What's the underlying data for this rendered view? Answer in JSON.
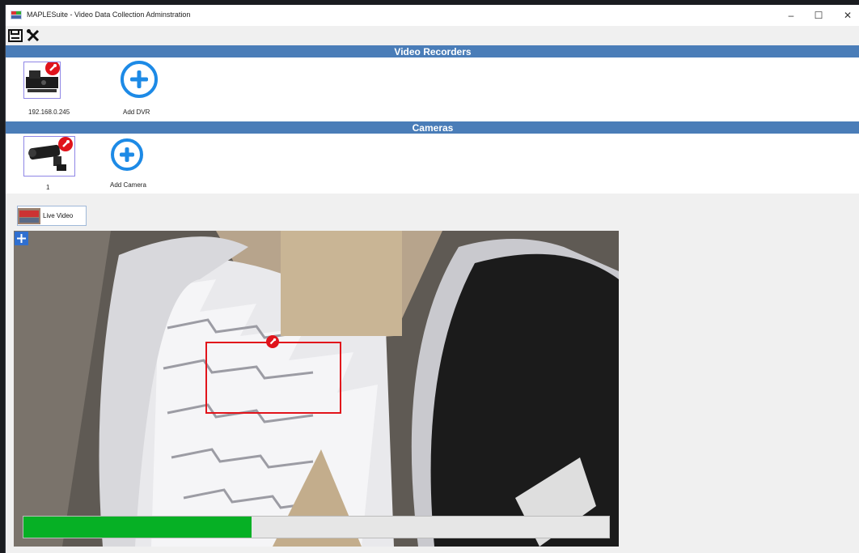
{
  "window": {
    "title": "MAPLESuite - Video Data Collection Adminstration",
    "minimize_glyph": "–",
    "maximize_glyph": "☐",
    "close_glyph": "✕"
  },
  "toolbar": {
    "save_icon": "save-icon",
    "settings_icon": "tools-icon"
  },
  "video_recorders": {
    "header": "Video Recorders",
    "items": [
      {
        "label": "192.168.0.245",
        "status": "error"
      }
    ],
    "add_label": "Add DVR"
  },
  "cameras": {
    "header": "Cameras",
    "items": [
      {
        "label": "1",
        "status": "error"
      }
    ],
    "add_label": "Add Camera"
  },
  "tabs": [
    {
      "label": "Live Video",
      "active": true
    }
  ],
  "live_video": {
    "progress": 0.39,
    "progress_color": "#06b025",
    "roi_color": "#e1141b"
  },
  "colors": {
    "section_header": "#4a7db8",
    "add_icon": "#1d8ae6",
    "badge": "#e0141c"
  }
}
